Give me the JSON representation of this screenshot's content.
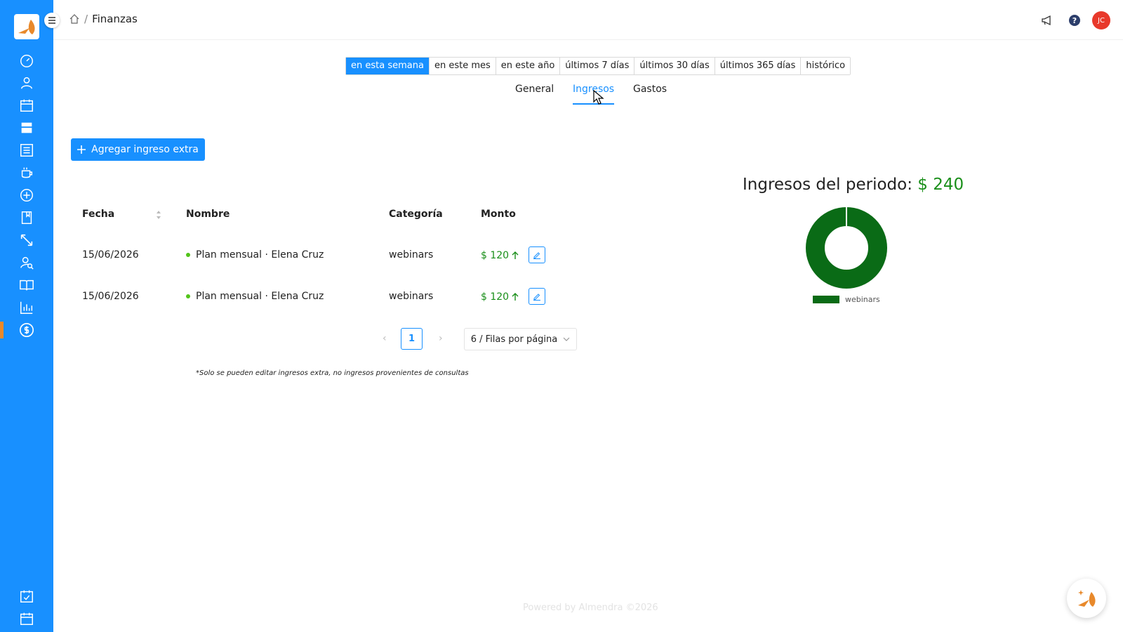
{
  "breadcrumb": {
    "title": "Finanzas"
  },
  "header": {
    "avatar_initials": "JC"
  },
  "periods": [
    "en esta semana",
    "en este mes",
    "en este año",
    "últimos 7 días",
    "últimos 30 días",
    "últimos 365 días",
    "histórico"
  ],
  "tabs": [
    "General",
    "Ingresos",
    "Gastos"
  ],
  "add_button": {
    "label": "Agregar ingreso extra"
  },
  "table": {
    "headers": {
      "fecha": "Fecha",
      "nombre": "Nombre",
      "categoria": "Categoría",
      "monto": "Monto"
    },
    "rows": [
      {
        "fecha": "15/06/2026",
        "nombre": "Plan mensual · Elena Cruz",
        "categoria": "webinars",
        "monto": "$ 120"
      },
      {
        "fecha": "15/06/2026",
        "nombre": "Plan mensual · Elena Cruz",
        "categoria": "webinars",
        "monto": "$ 120"
      }
    ]
  },
  "pagination": {
    "page": "1",
    "page_size": "6 / Filas por página"
  },
  "footnote": "*Solo se pueden editar ingresos extra, no ingresos provenientes de consultas",
  "chart_title": {
    "label": "Ingresos del periodo:",
    "amount": "$ 240"
  },
  "chart_data": {
    "type": "pie",
    "title": "Ingresos del periodo: $ 240",
    "categories": [
      "webinars"
    ],
    "values": [
      240
    ],
    "legend": "bottom",
    "colors": [
      "#0a6b16"
    ]
  },
  "footer": "Powered by Almendra ©2026",
  "colors": {
    "primary": "#1890ff",
    "income": "#1a8f1a",
    "donut": "#0a6b16"
  }
}
